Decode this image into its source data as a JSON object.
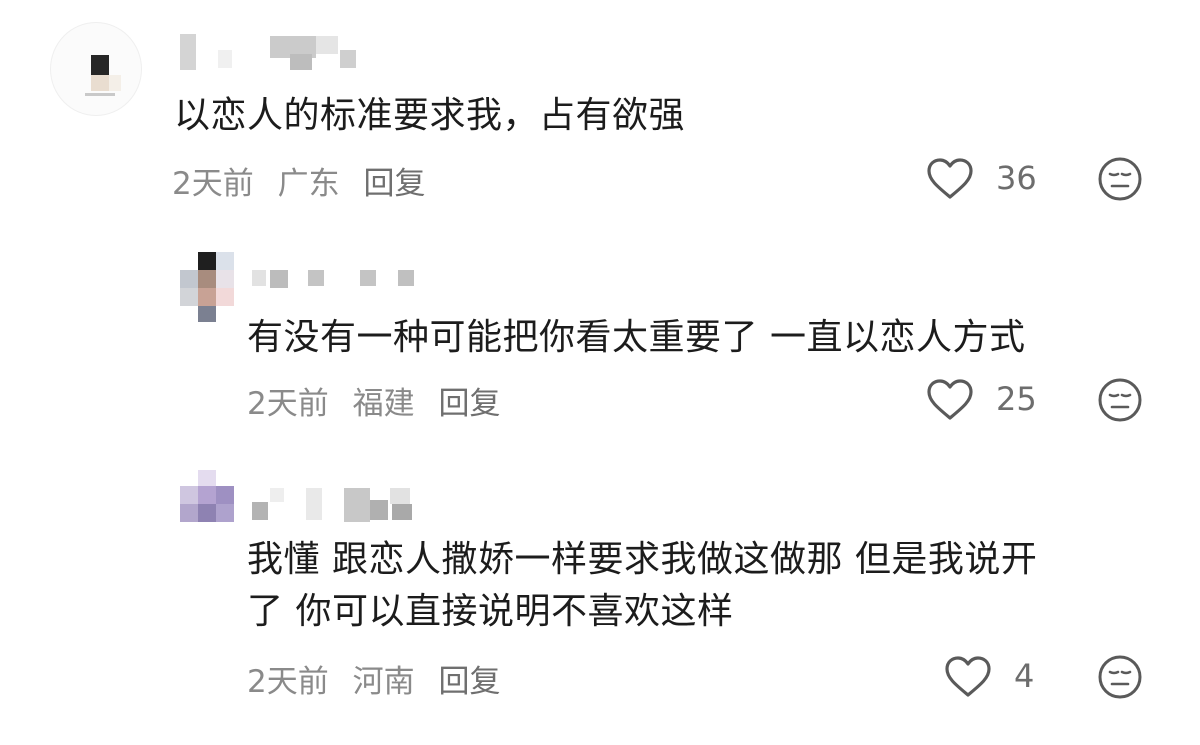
{
  "comments": [
    {
      "text": "以恋人的标准要求我，占有欲强",
      "time": "2天前",
      "location": "广东",
      "reply": "回复",
      "likes": "36"
    },
    {
      "text": "有没有一种可能把你看太重要了 一直以恋人方式",
      "time": "2天前",
      "location": "福建",
      "reply": "回复",
      "likes": "25"
    },
    {
      "text": "我懂 跟恋人撒娇一样要求我做这做那 但是我说开\n了 你可以直接说明不喜欢这样",
      "time": "2天前",
      "location": "河南",
      "reply": "回复",
      "likes": "4"
    }
  ],
  "icons": {
    "like": "heart-outline-icon",
    "react": "neutral-face-icon"
  },
  "colors": {
    "text": "#1c1c1c",
    "meta": "#8a8a8a",
    "icon": "#5a5a5a"
  }
}
